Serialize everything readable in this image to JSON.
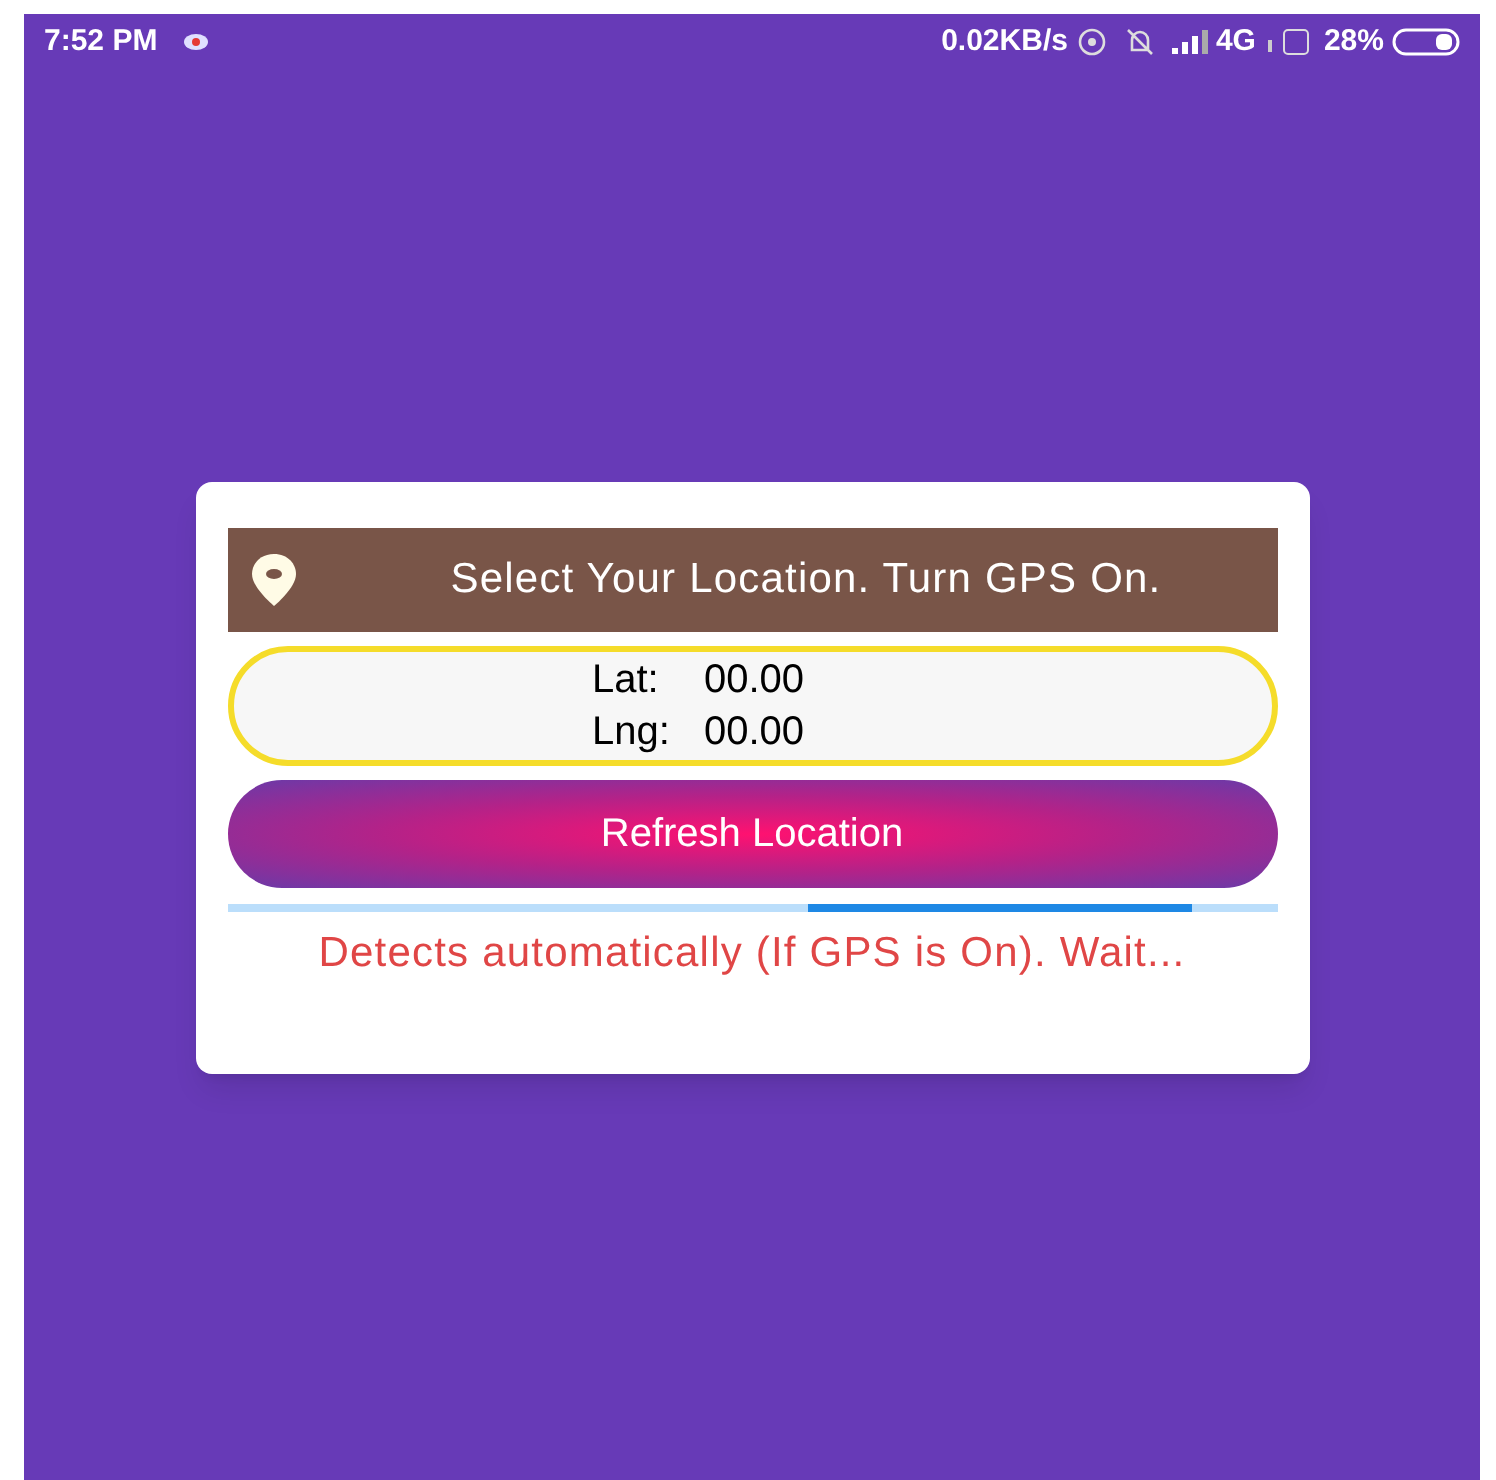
{
  "status_bar": {
    "time": "7:52 PM",
    "speed": "0.02KB/s",
    "network": "4G",
    "battery": "28%"
  },
  "dialog": {
    "header": "Select Your Location. Turn GPS On.",
    "coordinates": [
      {
        "label": "Lat:",
        "value": "00.00"
      },
      {
        "label": "Lng:",
        "value": "00.00"
      }
    ],
    "button": "Refresh Location",
    "message": "Detects automatically (If GPS is On). Wait..."
  }
}
